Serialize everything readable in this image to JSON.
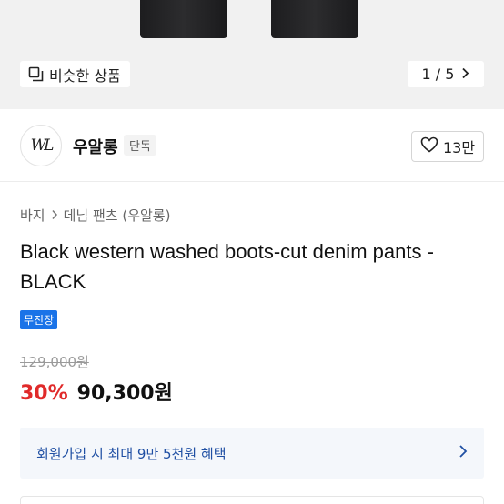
{
  "gallery": {
    "similar_label": "비슷한 상품",
    "pager_text": "1 / 5",
    "similar_icon": "similar-products-icon",
    "next_icon": "chevron-right-icon"
  },
  "brand": {
    "logo_text": "WL",
    "name": "우알롱",
    "badge": "단독",
    "like_count": "13만",
    "like_icon": "heart-icon"
  },
  "breadcrumb": {
    "items": [
      "바지",
      "데님 팬츠 (우알롱)"
    ],
    "separator_icon": "chevron-right-icon"
  },
  "product": {
    "title": "Black western washed boots-cut denim pants - BLACK",
    "free_shipping": "무진장",
    "original_price": "129,000원",
    "discount": "30%",
    "price": "90,300원"
  },
  "benefit": {
    "text": "회원가입 시 최대 9만 5천원 혜택",
    "icon": "chevron-right-icon"
  },
  "colors": {
    "discount": "#e02a2a",
    "badge_blue": "#1a73e8",
    "benefit_text": "#1f4fa3",
    "benefit_bg": "#f4f7fb"
  }
}
